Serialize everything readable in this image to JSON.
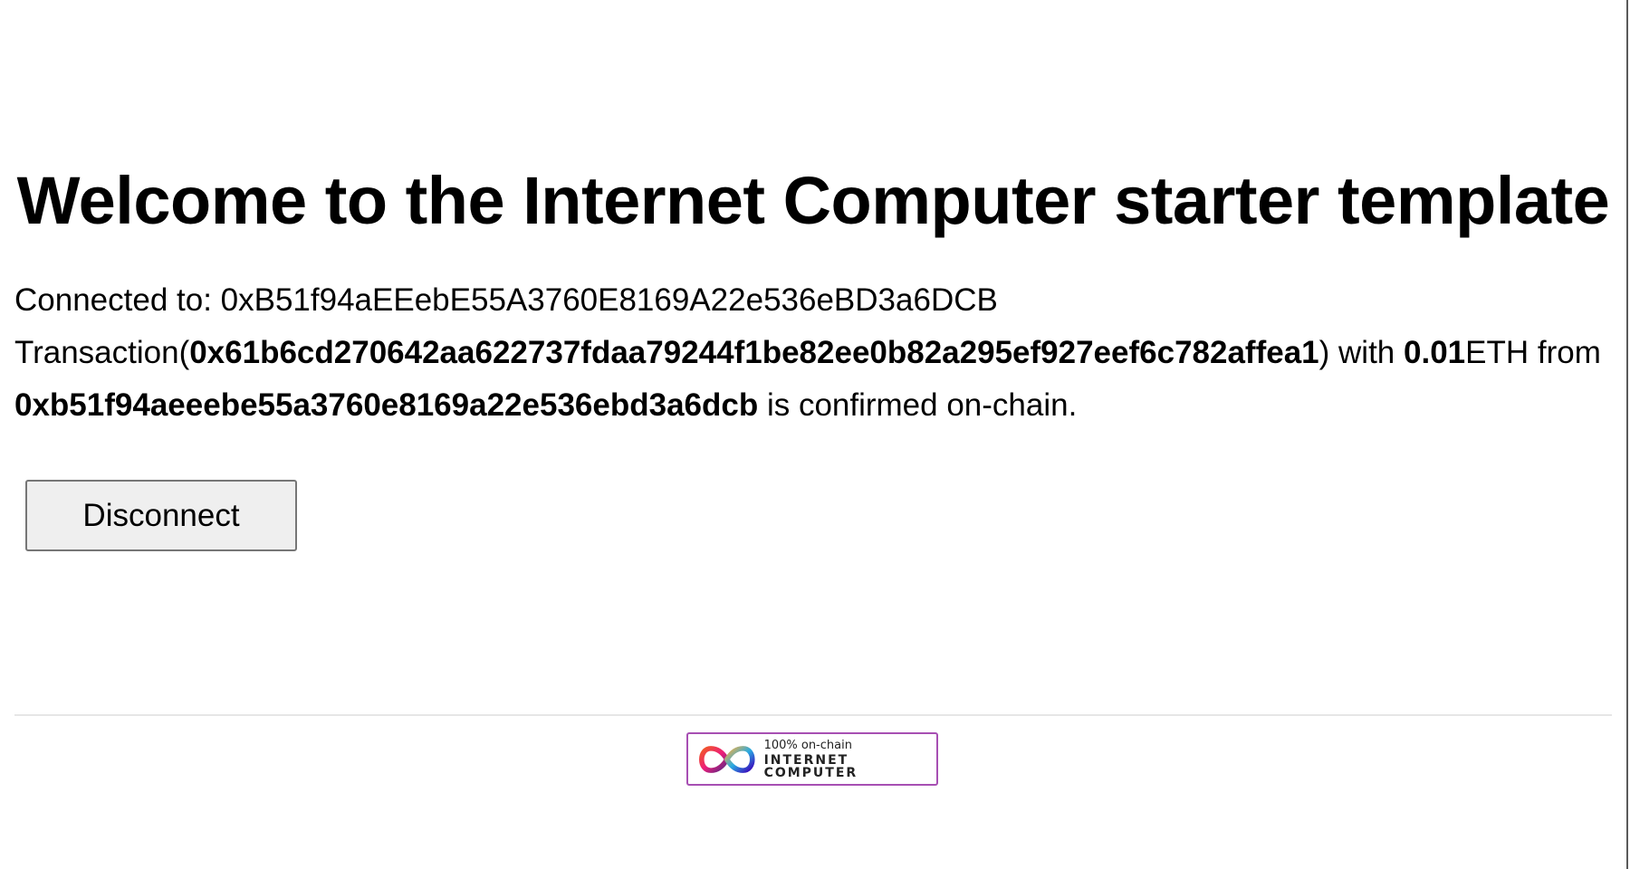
{
  "page": {
    "title": "Welcome to the Internet Computer starter template"
  },
  "status": {
    "connected_label": "Connected to: ",
    "connected_address": "0xB51f94aEEebE55A3760E8169A22e536eBD3a6DCB",
    "tx_prefix": "Transaction(",
    "tx_hash": "0x61b6cd270642aa622737fdaa79244f1be82ee0b82a295ef927eef6c782affea1",
    "tx_mid": ") with ",
    "amount": "0.01",
    "currency_from": "ETH from ",
    "from_address": "0xb51f94aeeebe55a3760e8169a22e536ebd3a6dcb",
    "tx_suffix": " is confirmed on-chain."
  },
  "actions": {
    "disconnect_label": "Disconnect"
  },
  "footer": {
    "badge_small": "100% on-chain",
    "badge_big": "INTERNET COMPUTER",
    "badge_icon": "infinity-logo-icon"
  },
  "colors": {
    "badge_border": "#a74fb3",
    "button_bg": "#efefef",
    "button_border": "#767676"
  }
}
